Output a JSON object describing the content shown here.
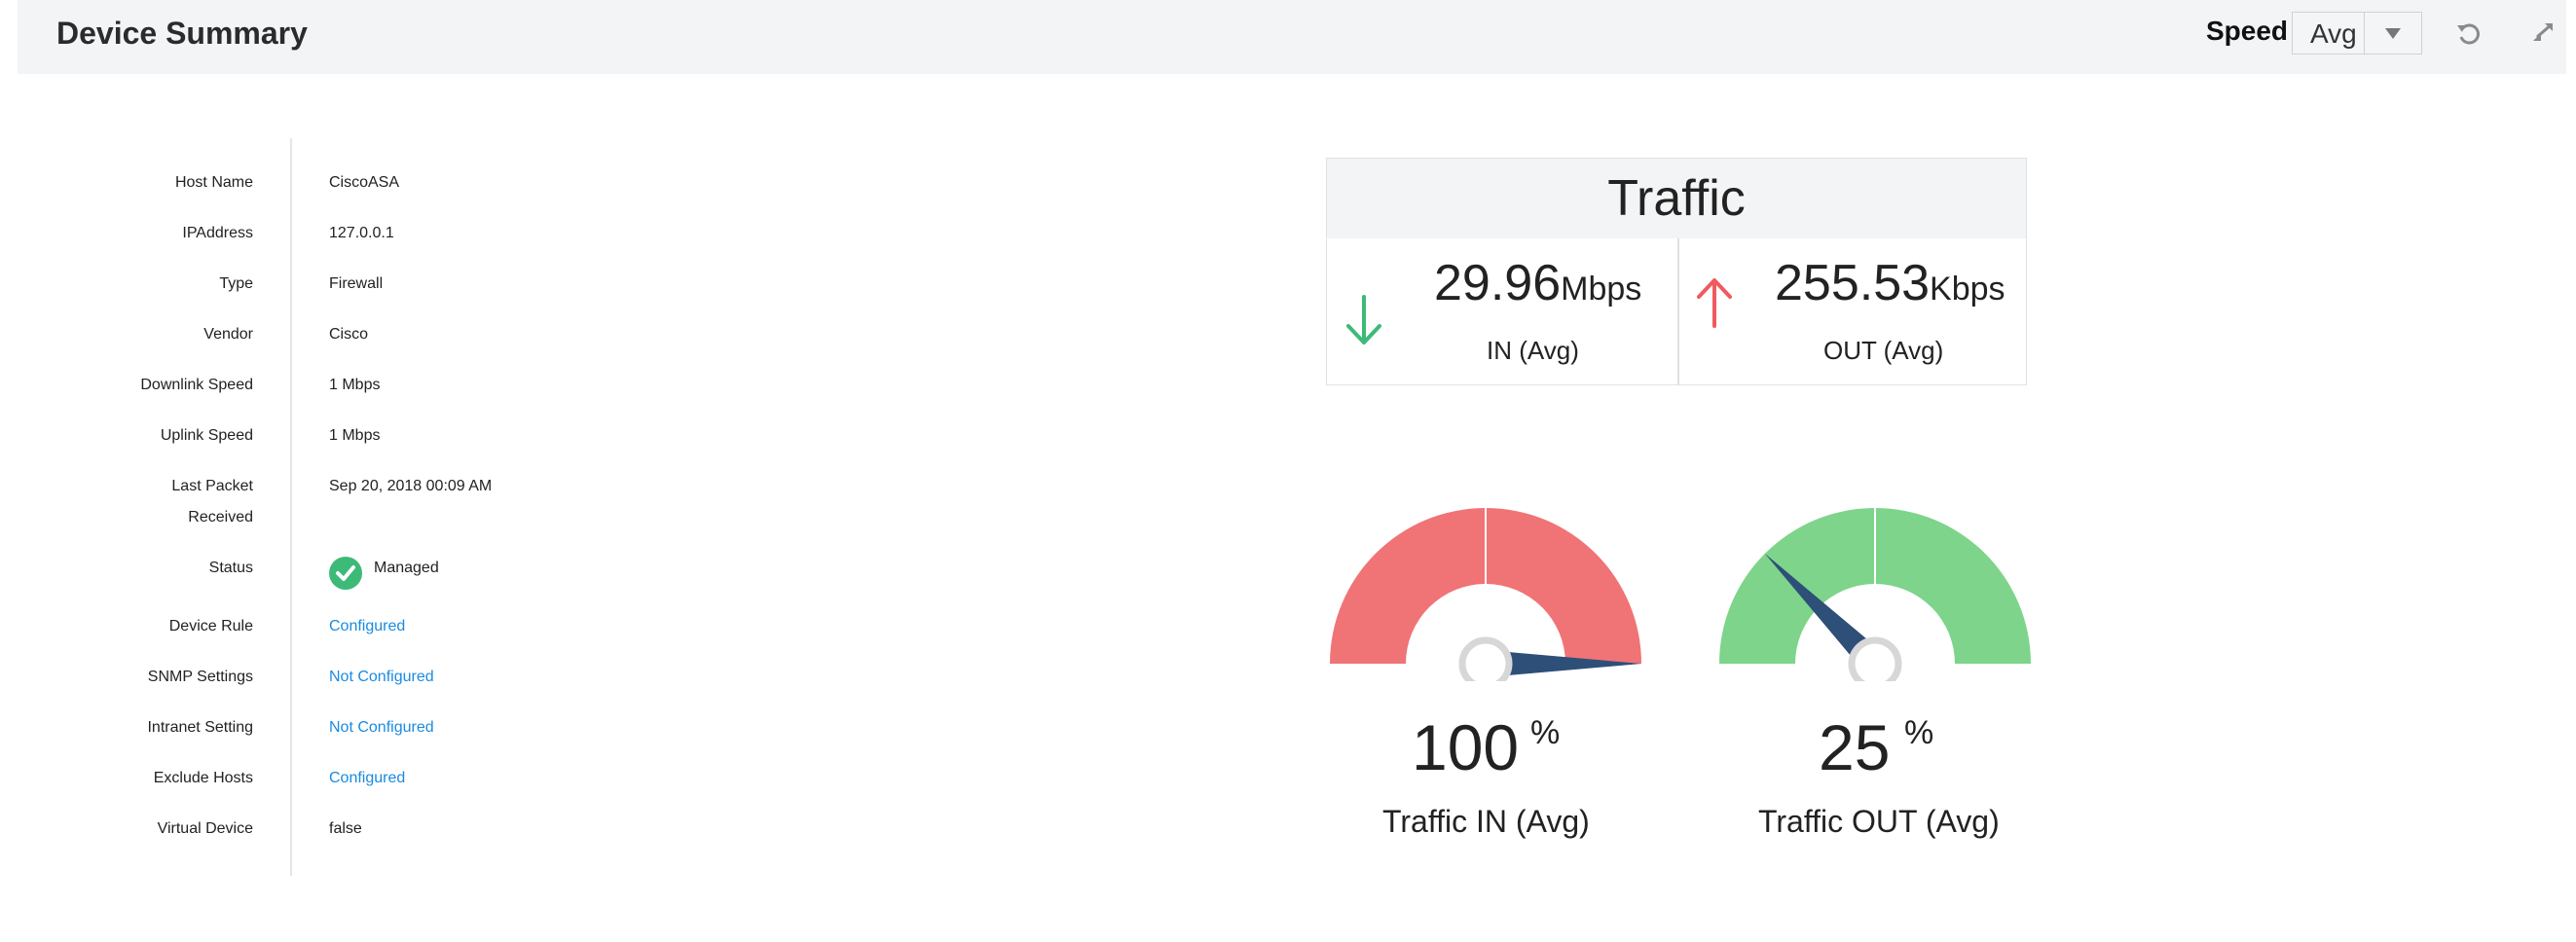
{
  "header": {
    "title": "Device Summary",
    "speed_label": "Speed",
    "speed_value": "Avg",
    "icons": [
      "refresh-icon",
      "collapse-icon"
    ]
  },
  "device_info": [
    {
      "label": "Host Name",
      "value": "CiscoASA"
    },
    {
      "label": "IPAddress",
      "value": "127.0.0.1"
    },
    {
      "label": "Type",
      "value": "Firewall"
    },
    {
      "label": "Vendor",
      "value": "Cisco"
    },
    {
      "label": "Downlink Speed",
      "value": "1 Mbps"
    },
    {
      "label": "Uplink Speed",
      "value": "1 Mbps"
    },
    {
      "label_line1": "Last Packet",
      "label_line2": "Received",
      "value": "Sep 20, 2018 00:09 AM"
    },
    {
      "label": "Status",
      "value": "Managed"
    },
    {
      "label": "Device Rule",
      "value": "Configured"
    },
    {
      "label": "SNMP Settings",
      "value": "Not Configured"
    },
    {
      "label": "Intranet Setting",
      "value": "Not Configured"
    },
    {
      "label": "Exclude Hosts",
      "value": "Configured"
    },
    {
      "label": "Virtual Device",
      "value": "false"
    }
  ],
  "traffic": {
    "title": "Traffic",
    "in": {
      "value": "29.96",
      "unit": "Mbps",
      "label": "IN (Avg)"
    },
    "out": {
      "value": "255.53",
      "unit": "Kbps",
      "label": "OUT (Avg)"
    }
  },
  "gauges": [
    {
      "value": "100",
      "unit": "%",
      "label": "Traffic IN (Avg)",
      "level": 1.0,
      "color": "#f07376"
    },
    {
      "value": "25",
      "unit": "%",
      "label": "Traffic OUT (Avg)",
      "level": 0.25,
      "color": "#7dd48a"
    }
  ],
  "colors": {
    "link": "#1a8be0",
    "in_arrow": "#3dba78",
    "out_arrow": "#f05a5f",
    "status_ok": "#3dba78",
    "needle": "#2e4f78"
  }
}
